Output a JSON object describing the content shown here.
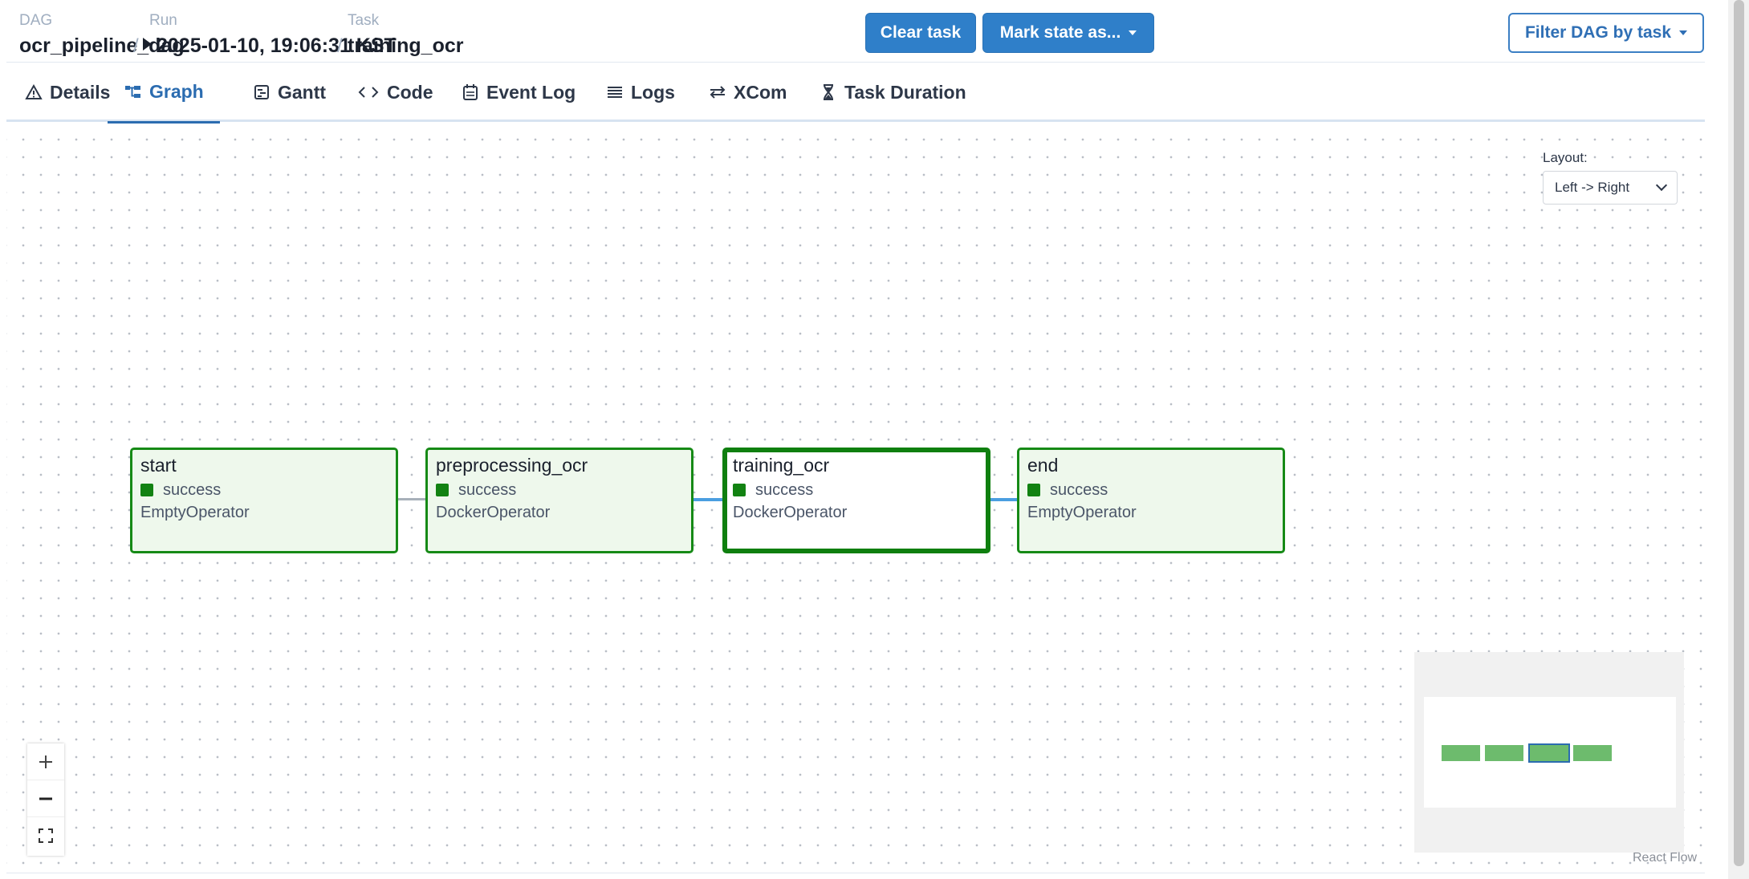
{
  "breadcrumb": {
    "dag": {
      "label": "DAG",
      "value": "ocr_pipeline_dag"
    },
    "run": {
      "label": "Run",
      "value": "2025-01-10, 19:06:31 KST"
    },
    "task": {
      "label": "Task",
      "value": "training_ocr"
    },
    "separator": "/"
  },
  "actions": {
    "clear_task": "Clear task",
    "mark_state": "Mark state as...",
    "filter_dag": "Filter DAG by task"
  },
  "tabs": [
    {
      "label": "Details",
      "icon": "warning-triangle-icon"
    },
    {
      "label": "Graph",
      "icon": "graph-icon",
      "active": true
    },
    {
      "label": "Gantt",
      "icon": "gantt-icon"
    },
    {
      "label": "Code",
      "icon": "code-icon"
    },
    {
      "label": "Event Log",
      "icon": "event-log-icon"
    },
    {
      "label": "Logs",
      "icon": "logs-icon"
    },
    {
      "label": "XCom",
      "icon": "xcom-icon"
    },
    {
      "label": "Task Duration",
      "icon": "hourglass-icon"
    }
  ],
  "layout": {
    "label": "Layout:",
    "value": "Left -> Right"
  },
  "nodes": [
    {
      "name": "start",
      "state": "success",
      "operator": "EmptyOperator"
    },
    {
      "name": "preprocessing_ocr",
      "state": "success",
      "operator": "DockerOperator"
    },
    {
      "name": "training_ocr",
      "state": "success",
      "operator": "DockerOperator",
      "selected": true
    },
    {
      "name": "end",
      "state": "success",
      "operator": "EmptyOperator"
    }
  ],
  "colors": {
    "success": "#128212",
    "node_border": "#168a16",
    "node_fill": "#eef8ec",
    "accent": "#2b6cb0",
    "edge_default": "#a8b0ba",
    "edge_highlight": "#4a9ee0"
  },
  "attribution": "React Flow"
}
